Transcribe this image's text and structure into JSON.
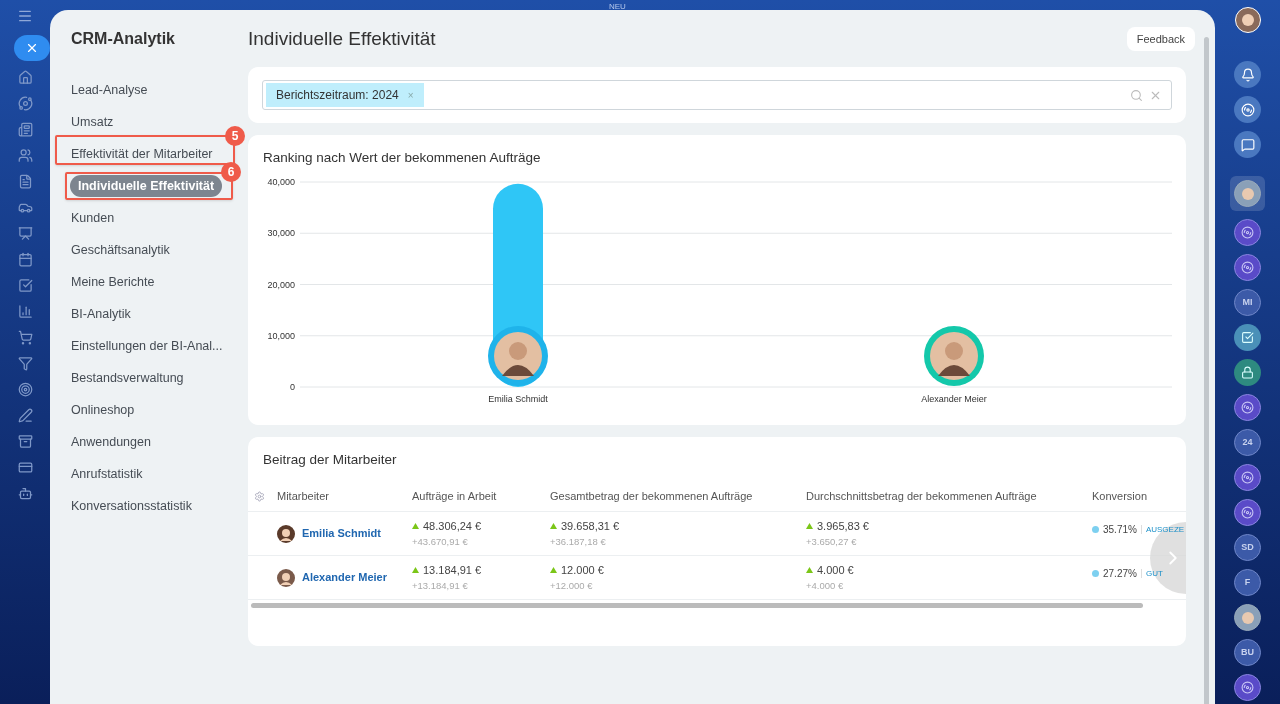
{
  "top_label": "NEU",
  "sidebar": {
    "title": "CRM-Analytik",
    "items": [
      {
        "label": "Lead-Analyse",
        "selected": false
      },
      {
        "label": "Umsatz",
        "selected": false
      },
      {
        "label": "Effektivität der Mitarbeiter",
        "selected": false,
        "callout": "5"
      },
      {
        "label": "Individuelle Effektivität",
        "selected": true,
        "callout": "6"
      },
      {
        "label": "Kunden",
        "selected": false
      },
      {
        "label": "Geschäftsanalytik",
        "selected": false
      },
      {
        "label": "Meine Berichte",
        "selected": false
      },
      {
        "label": "BI-Analytik",
        "selected": false
      },
      {
        "label": "Einstellungen der BI-Anal...",
        "selected": false
      },
      {
        "label": "Bestandsverwaltung",
        "selected": false
      },
      {
        "label": "Onlineshop",
        "selected": false
      },
      {
        "label": "Anwendungen",
        "selected": false
      },
      {
        "label": "Anrufstatistik",
        "selected": false
      },
      {
        "label": "Konversationsstatistik",
        "selected": false
      }
    ]
  },
  "page": {
    "title": "Individuelle Effektivität",
    "feedback_button": "Feedback"
  },
  "filter": {
    "tag": "Berichtszeitraum: 2024",
    "tag_remove": "×"
  },
  "ranking": {
    "title": "Ranking nach Wert der bekommenen Aufträge",
    "markers": [
      {
        "color": "#1fb3ea"
      },
      {
        "color": "#14c8aa"
      }
    ],
    "chart_data": {
      "type": "bar",
      "categories": [
        "Emilia Schmidt",
        "Alexander Meier"
      ],
      "series": [
        {
          "color": "#2fc6f6",
          "values": [
            39660,
            null
          ]
        }
      ],
      "grid": true,
      "ylim": [
        0,
        40000
      ],
      "yticks": [
        {
          "value": 0,
          "label": "0"
        },
        {
          "value": 10000,
          "label": "10,000"
        },
        {
          "value": 20000,
          "label": "20,000"
        },
        {
          "value": 30000,
          "label": "30,000"
        },
        {
          "value": 40000,
          "label": "40,000"
        }
      ]
    }
  },
  "contribution": {
    "title": "Beitrag der Mitarbeiter",
    "columns": [
      "Mitarbeiter",
      "Aufträge in Arbeit",
      "Gesamtbetrag der bekommenen Aufträge",
      "Durchschnittsbetrag der bekommenen Aufträge",
      "Konversion"
    ],
    "rows": [
      {
        "cells": [
          {
            "kind": "person",
            "name": "Emilia Schmidt"
          },
          {
            "kind": "amount",
            "value": "48.306,24 €",
            "delta": "+43.670,91 €"
          },
          {
            "kind": "amount",
            "value": "39.658,31 €",
            "delta": "+36.187,18 €"
          },
          {
            "kind": "amount",
            "value": "3.965,83 €",
            "delta": "+3.650,27 €"
          },
          {
            "kind": "conversion",
            "percent": "35.71%",
            "rating": "AUSGEZE",
            "color": "#7dd0f0"
          }
        ]
      },
      {
        "cells": [
          {
            "kind": "person",
            "name": "Alexander Meier"
          },
          {
            "kind": "amount",
            "value": "13.184,91 €",
            "delta": "+13.184,91 €"
          },
          {
            "kind": "amount",
            "value": "12.000 €",
            "delta": "+12.000 €"
          },
          {
            "kind": "amount",
            "value": "4.000 €",
            "delta": "+4.000 €"
          },
          {
            "kind": "conversion",
            "percent": "27.27%",
            "rating": "GUT",
            "color": "#7dd0f0"
          }
        ]
      }
    ]
  },
  "right_rail": [
    {
      "kind": "icon"
    },
    {
      "kind": "icon"
    },
    {
      "kind": "icon"
    },
    {
      "kind": "photo"
    },
    {
      "kind": "chat"
    },
    {
      "kind": "chat"
    },
    {
      "kind": "initials",
      "text": "MI"
    },
    {
      "kind": "task"
    },
    {
      "kind": "lock"
    },
    {
      "kind": "chat"
    },
    {
      "kind": "initials",
      "text": "24"
    },
    {
      "kind": "chat"
    },
    {
      "kind": "chat"
    },
    {
      "kind": "initials",
      "text": "SD"
    },
    {
      "kind": "initials",
      "text": "F"
    },
    {
      "kind": "photo"
    },
    {
      "kind": "initials",
      "text": "BU"
    },
    {
      "kind": "chat"
    }
  ]
}
